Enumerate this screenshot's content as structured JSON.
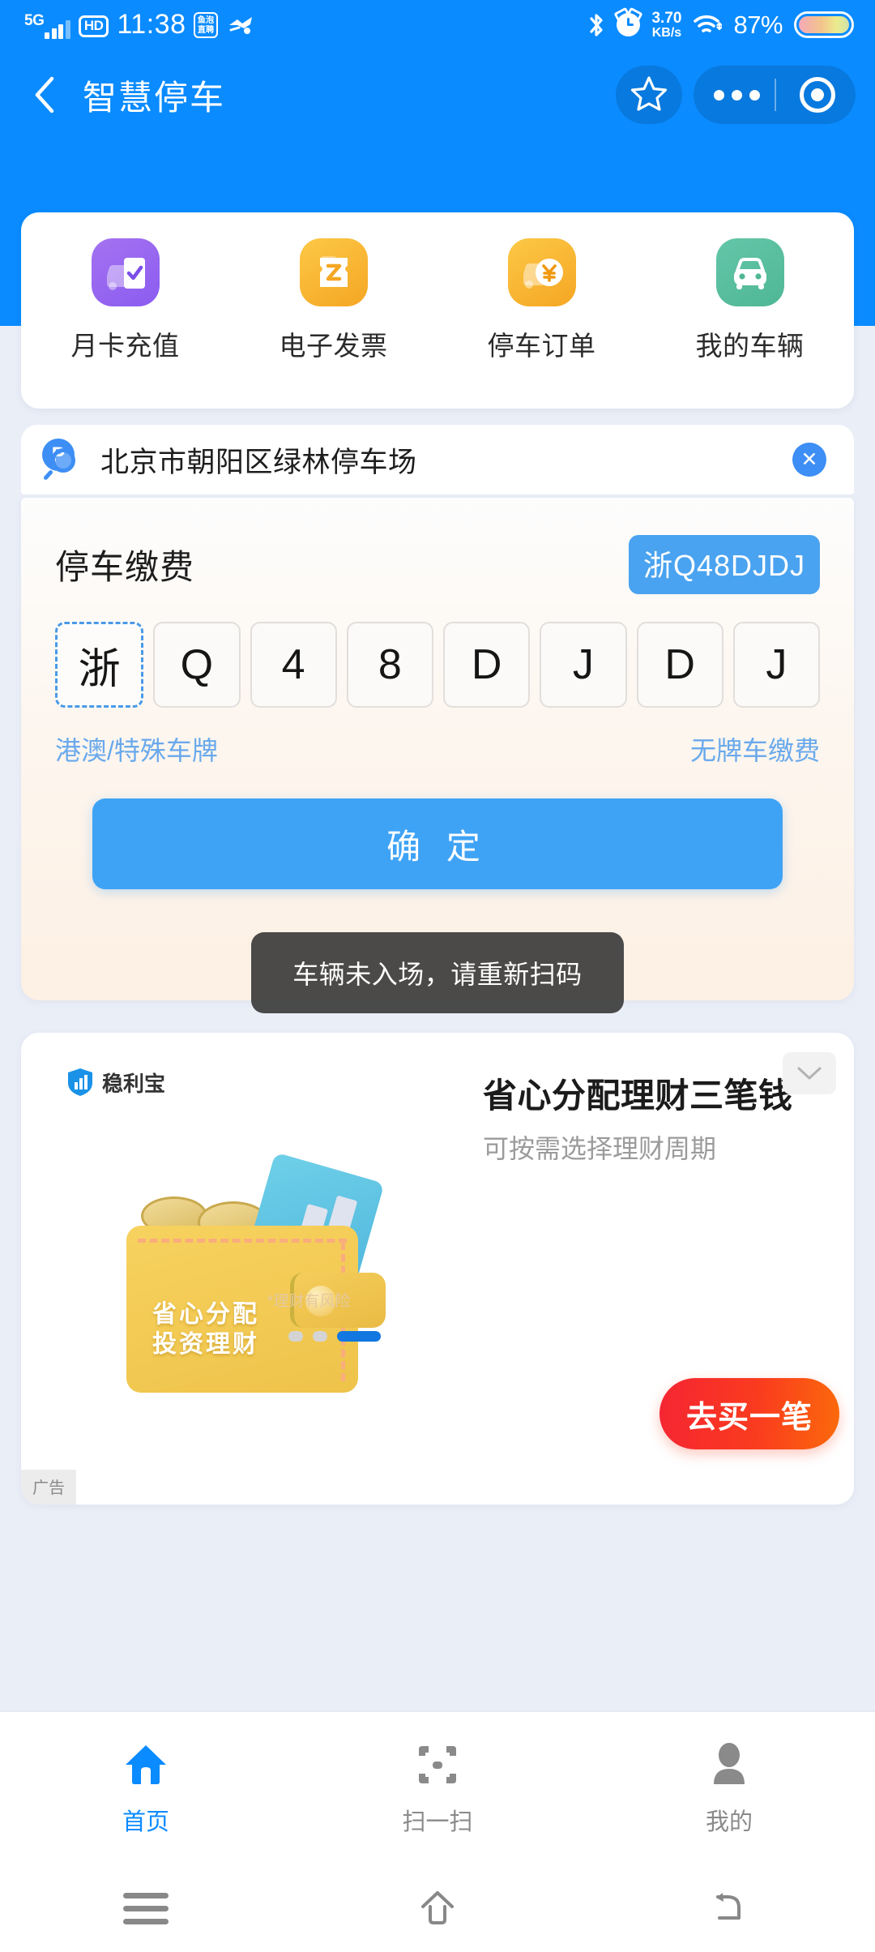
{
  "statusbar": {
    "network_type": "5G",
    "hd_badge": "HD",
    "time": "11:38",
    "app_icon_1_line1": "鱼泡",
    "app_icon_1_line2": "直聘",
    "net_speed_value": "3.70",
    "net_speed_unit": "KB/s",
    "battery_percent": "87%",
    "bluetooth_icon": "bluetooth-icon",
    "alarm_icon": "alarm-icon",
    "wifi_icon": "wifi-icon"
  },
  "header": {
    "back_icon": "back-chevron-icon",
    "title": "智慧停车",
    "star_icon": "star-icon",
    "more_icon": "more-dots-icon",
    "target_icon": "target-circle-icon",
    "brand_blue": "#0a8bff"
  },
  "quick_actions": [
    {
      "label": "月卡充值",
      "icon": "monthly-card-recharge-icon",
      "color": "#8b5cf0"
    },
    {
      "label": "电子发票",
      "icon": "e-invoice-icon",
      "color": "#f5a623"
    },
    {
      "label": "停车订单",
      "icon": "parking-order-icon",
      "color": "#f5a623"
    },
    {
      "label": "我的车辆",
      "icon": "my-vehicle-icon",
      "color": "#4fb795"
    }
  ],
  "search": {
    "icon": "parking-search-icon",
    "value": "北京市朝阳区绿林停车场",
    "clear_icon": "clear-x-icon"
  },
  "payment": {
    "title": "停车缴费",
    "plate_badge": "浙Q48DJDJ",
    "plate_chars": [
      "浙",
      "Q",
      "4",
      "8",
      "D",
      "J",
      "D",
      "J"
    ],
    "active_index": 0,
    "link_left": "港澳/特殊车牌",
    "link_right": "无牌车缴费",
    "confirm_label": "确 定",
    "accent_color": "#3fa3f5"
  },
  "toast": {
    "message": "车辆未入场，请重新扫码"
  },
  "ad": {
    "brand": "稳利宝",
    "brand_icon": "shield-chart-icon",
    "title": "省心分配理财三笔钱",
    "subtitle": "可按需选择理财周期",
    "collapse_icon": "chevron-down-icon",
    "cta_label": "去买一笔",
    "risk_note": "*理财有风险",
    "label": "广告",
    "illustration_line1": "省心分配",
    "illustration_line2": "投资理财",
    "carousel_dots": 3,
    "carousel_active": 2,
    "cta_gradient_start": "#f52533",
    "cta_gradient_end": "#fb6a0b"
  },
  "tabbar": {
    "items": [
      {
        "label": "首页",
        "icon": "home-icon",
        "active": true
      },
      {
        "label": "扫一扫",
        "icon": "scan-qr-icon",
        "active": false
      },
      {
        "label": "我的",
        "icon": "profile-person-icon",
        "active": false
      }
    ],
    "active_color": "#0a8bff"
  },
  "navbar": {
    "recents_icon": "recents-menu-icon",
    "home_icon": "home-outline-icon",
    "back_icon": "back-return-icon"
  }
}
